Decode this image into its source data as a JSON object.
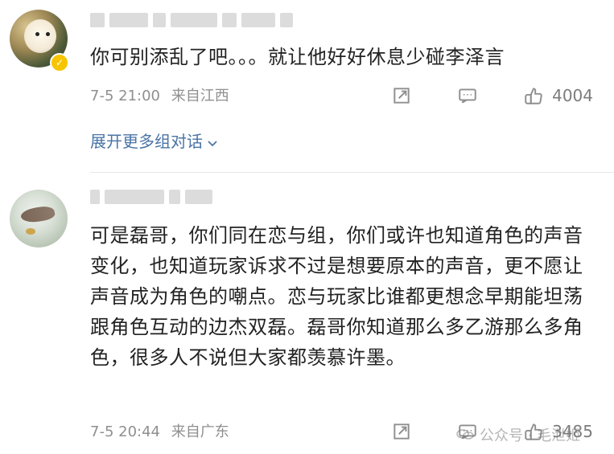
{
  "comments": [
    {
      "text": "你可别添乱了吧。。。就让他好好休息少碰李泽言",
      "time": "7-5 21:00",
      "location": "来自江西",
      "likes": "4004",
      "expand_text": "展开更多组对话"
    },
    {
      "text": "可是磊哥，你们同在恋与组，你们或许也知道角色的声音变化，也知道玩家诉求不过是想要原本的声音，更不愿让声音成为角色的嘲点。恋与玩家比谁都更想念早期能坦荡跟角色互动的边杰双磊。磊哥你知道那么多乙游那么多角色，很多人不说但大家都羡慕许墨。",
      "time": "7-5 20:44",
      "location": "来自广东",
      "likes": "3485"
    }
  ],
  "watermark": {
    "label": "公众号 · 毛泄姬"
  },
  "colors": {
    "link": "#4a74a6",
    "meta": "#8f8f8f",
    "text": "#222222"
  },
  "icons": [
    "share-icon",
    "comment-icon",
    "like-icon",
    "verified-badge-icon",
    "chevron-down-icon"
  ]
}
